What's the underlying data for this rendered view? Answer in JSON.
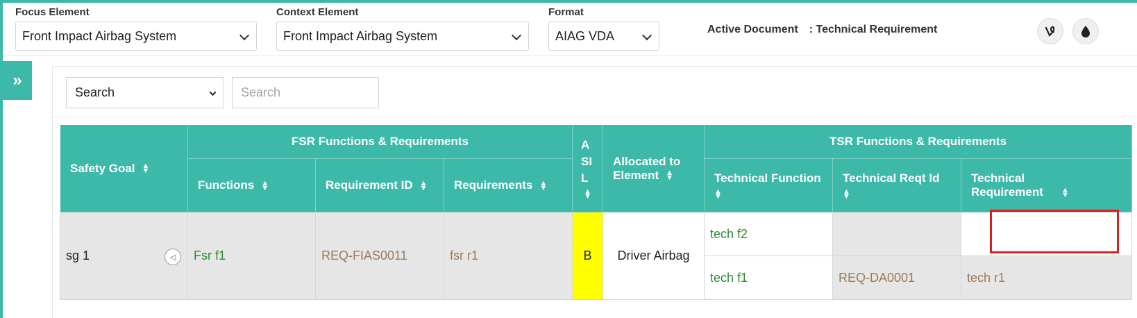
{
  "header": {
    "focus": {
      "label": "Focus Element",
      "value": "Front Impact Airbag System"
    },
    "context": {
      "label": "Context Element",
      "value": "Front Impact Airbag System"
    },
    "format": {
      "label": "Format",
      "value": "AIAG VDA"
    },
    "active_document": {
      "label": "Active Document",
      "value": ": Technical Requirement"
    },
    "icons": [
      "vine-icon",
      "drop-icon"
    ]
  },
  "sidebar": {
    "toggle_glyph": "»"
  },
  "search": {
    "select_value": "Search",
    "input_placeholder": "Search"
  },
  "table": {
    "groups": {
      "fsr": "FSR Functions & Requirements",
      "tsr": "TSR Functions & Requirements"
    },
    "columns": {
      "safety_goal": "Safety Goal",
      "functions": "Functions",
      "requirement_id": "Requirement ID",
      "requirements": "Requirements",
      "asil": "A SI L",
      "allocated": "Allocated to Element",
      "tech_function": "Technical Function",
      "tech_reqt_id": "Technical Reqt Id",
      "tech_requirement": "Technical Requirement"
    },
    "row": {
      "safety_goal": "sg 1",
      "function": "Fsr f1",
      "requirement_id": "REQ-FIAS0011",
      "requirement": "fsr r1",
      "asil": "B",
      "allocated": "Driver Airbag",
      "tech": [
        {
          "function": "tech f2",
          "reqt_id": "",
          "requirement": ""
        },
        {
          "function": "tech f1",
          "reqt_id": "REQ-DA0001",
          "requirement": "tech r1"
        }
      ]
    },
    "colors": {
      "header": "#3cb9a9",
      "asil_b": "#ffff00",
      "highlight": "#d61f1f"
    }
  }
}
